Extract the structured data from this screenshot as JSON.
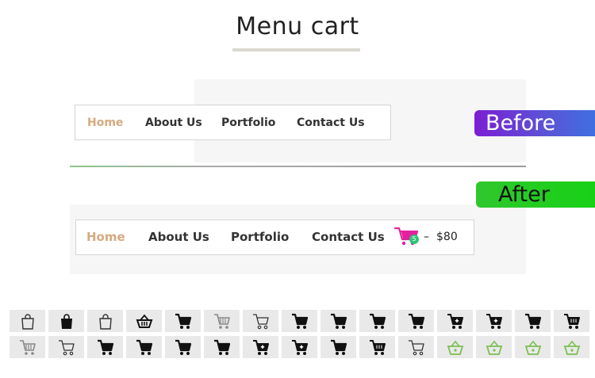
{
  "page": {
    "title": "Menu cart"
  },
  "labels": {
    "before": "Before",
    "after": "After"
  },
  "nav_before": {
    "items": [
      "Home",
      "About Us",
      "Portfolio",
      "Contact Us"
    ]
  },
  "nav_after": {
    "items": [
      "Home",
      "About Us",
      "Portfolio",
      "Contact Us"
    ],
    "cart": {
      "count": "5",
      "separator": "–",
      "total": "$80"
    }
  },
  "colors": {
    "home_active": "#d4ab80",
    "cart_icon": "#e3219f",
    "cart_badge": "#2fc478",
    "green_icons": "#7cbf52"
  },
  "icon_grid": {
    "row1": [
      "shopping-bag-outline-icon",
      "shopping-bag-filled-icon",
      "shopping-bag-outline-icon",
      "basket-icon",
      "cart-filled-icon",
      "cart-outline-grey-icon",
      "cart-outline-icon",
      "cart-filled-icon",
      "cart-filled-icon",
      "cart-filled-icon",
      "cart-filled-icon",
      "cart-plus-icon",
      "cart-plus-icon",
      "cart-filled-icon",
      "cart-basket-filled-icon"
    ],
    "row2": [
      "cart-outline-grey-icon",
      "cart-outline-icon",
      "cart-filled-icon",
      "cart-filled-icon",
      "cart-filled-icon",
      "cart-filled-icon",
      "cart-plus-icon",
      "cart-plus-icon",
      "cart-filled-icon",
      "cart-basket-filled-icon",
      "cart-outline-icon",
      "basket-green-icon",
      "basket-green-icon",
      "basket-green-icon",
      "basket-green-icon"
    ]
  }
}
